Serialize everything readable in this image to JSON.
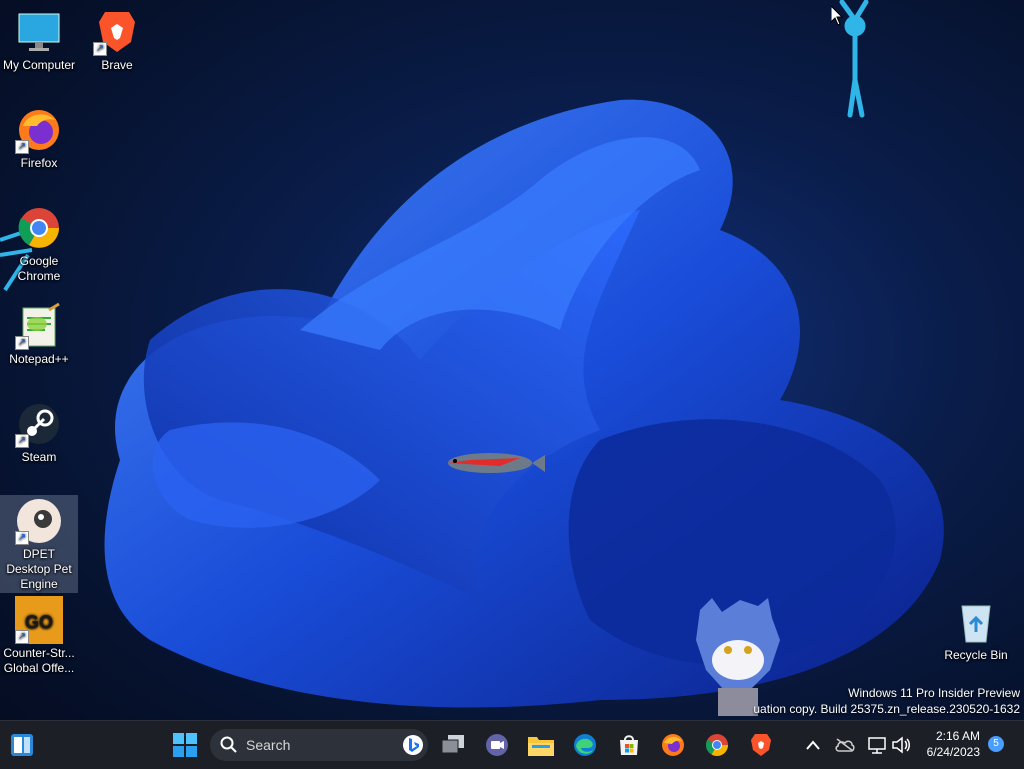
{
  "desktop_icons": [
    {
      "label": "My Computer",
      "icon": "monitor-icon"
    },
    {
      "label": "Brave",
      "icon": "brave-icon"
    },
    {
      "label": "Firefox",
      "icon": "firefox-icon"
    },
    {
      "label": "Google Chrome",
      "icon": "chrome-icon"
    },
    {
      "label": "Notepad++",
      "icon": "notepad-plus-plus-icon"
    },
    {
      "label": "Steam",
      "icon": "steam-icon"
    },
    {
      "label": "DPET Desktop Pet Engine",
      "icon": "dpet-icon"
    },
    {
      "label": "Counter-Str... Global Offe...",
      "icon": "csgo-icon"
    },
    {
      "label": "Recycle Bin",
      "icon": "recycle-bin-icon"
    }
  ],
  "watermark": {
    "line1": "Windows 11 Pro Insider Preview",
    "line2": "uation copy. Build 25375.zn_release.230520-1632"
  },
  "taskbar": {
    "search_label": "Search",
    "time": "2:16 AM",
    "date": "6/24/2023",
    "notification_count": "5",
    "pinned": [
      "start-icon",
      "task-view-icon",
      "teams-chat-icon",
      "file-explorer-icon",
      "edge-icon",
      "microsoft-store-icon",
      "firefox-icon",
      "chrome-icon",
      "brave-icon"
    ]
  },
  "colors": {
    "accent": "#1a6bff",
    "taskbar": "#1c1f26"
  }
}
